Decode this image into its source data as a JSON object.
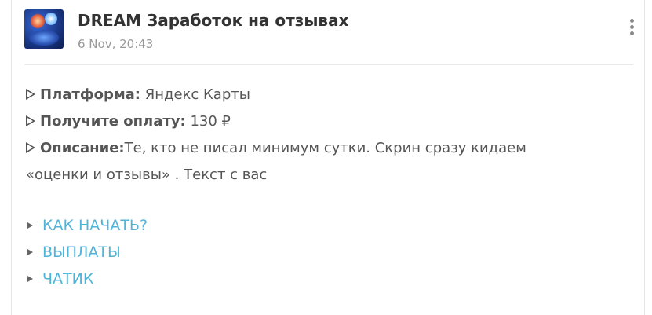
{
  "post": {
    "channel_name": "DREAM Заработок на отзывах",
    "timestamp": "6 Nov, 20:43",
    "menu_icon": "more-vertical-icon"
  },
  "content": {
    "platform_label": "Платформа:",
    "platform_value": "Яндекс Карты",
    "payment_label": "Получите оплату:",
    "payment_value": "130 ₽",
    "description_label": "Описание:",
    "description_line1": "Те, кто не писал минимум сутки. Скрин сразу кидаем",
    "description_line2": "«оценки и отзывы» . Текст с вас"
  },
  "links": [
    {
      "label": "КАК НАЧАТЬ?"
    },
    {
      "label": "ВЫПЛАТЫ"
    },
    {
      "label": "ЧАТИК"
    }
  ],
  "colors": {
    "link": "#4fb4d8",
    "text": "#555555",
    "title": "#333333",
    "muted": "#9a9a9a"
  }
}
